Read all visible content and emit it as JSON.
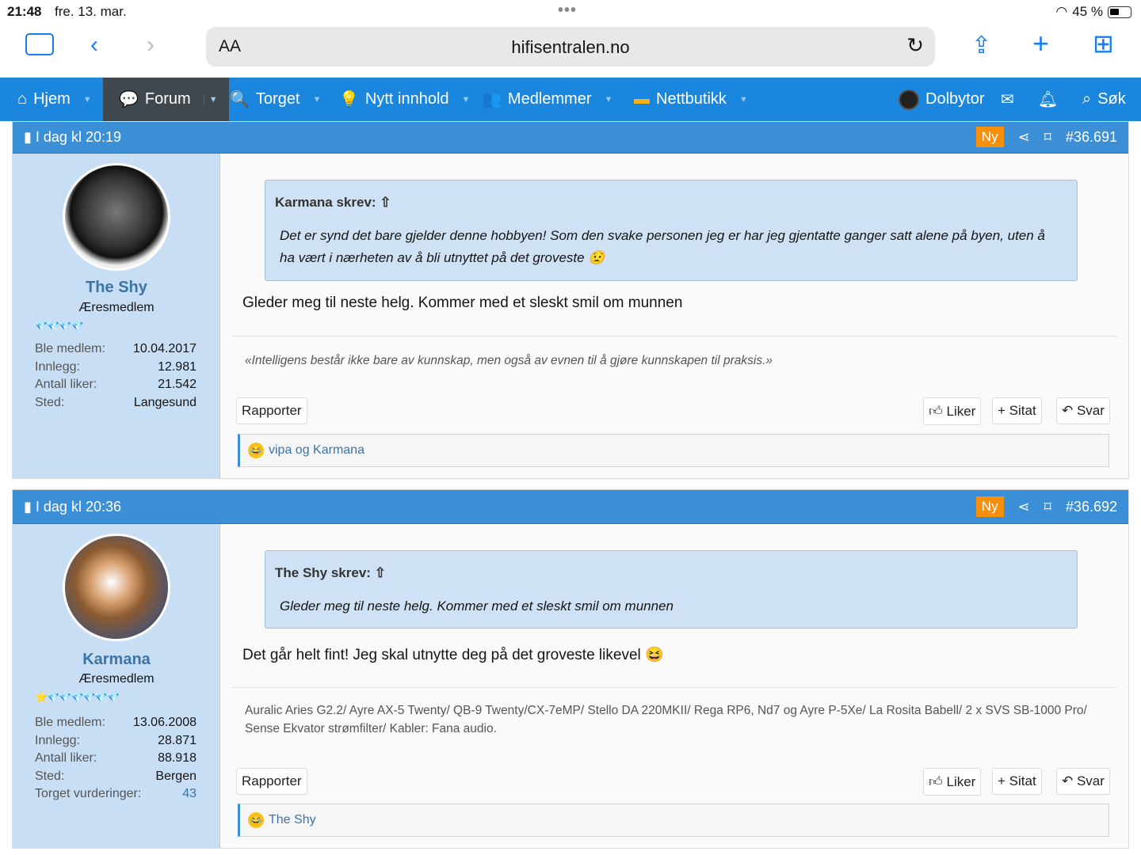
{
  "status": {
    "time": "21:48",
    "date": "fre. 13. mar.",
    "battery": "45 %"
  },
  "browser": {
    "text_size": "AA",
    "host": "hifisentralen.no"
  },
  "nav": {
    "items": [
      {
        "label": "Hjem"
      },
      {
        "label": "Forum"
      },
      {
        "label": "Torget"
      },
      {
        "label": "Nytt innhold"
      },
      {
        "label": "Medlemmer"
      },
      {
        "label": "Nettbutikk"
      }
    ],
    "user": "Dolbytor",
    "search": "Søk"
  },
  "posts": [
    {
      "date": "I dag kl 20:19",
      "badge": "Ny",
      "number": "#36.691",
      "username": "The Shy",
      "user_title": "Æresmedlem",
      "stats": [
        {
          "k": "Ble medlem:",
          "v": "10.04.2017"
        },
        {
          "k": "Innlegg:",
          "v": "12.981"
        },
        {
          "k": "Antall liker:",
          "v": "21.542"
        },
        {
          "k": "Sted:",
          "v": "Langesund"
        }
      ],
      "quote_author": "Karmana skrev:",
      "quote_text": "Det er synd det bare gjelder denne hobbyen! Som den svake personen jeg er har jeg gjentatte ganger satt alene på byen, uten å ha vært i nærheten av å bli utnyttet på det groveste 😟",
      "body": "Gleder meg til neste helg. Kommer med et sleskt smil om munnen",
      "signature": "«Intelligens består ikke bare av kunnskap, men også av evnen til å gjøre kunnskapen til praksis.»",
      "reactions": "vipa og Karmana"
    },
    {
      "date": "I dag kl 20:36",
      "badge": "Ny",
      "number": "#36.692",
      "username": "Karmana",
      "user_title": "Æresmedlem",
      "stats": [
        {
          "k": "Ble medlem:",
          "v": "13.06.2008"
        },
        {
          "k": "Innlegg:",
          "v": "28.871"
        },
        {
          "k": "Antall liker:",
          "v": "88.918"
        },
        {
          "k": "Sted:",
          "v": "Bergen"
        },
        {
          "k": "Torget vurderinger:",
          "v": "43"
        }
      ],
      "quote_author": "The Shy skrev:",
      "quote_text": "Gleder meg til neste helg. Kommer med et sleskt smil om munnen",
      "body": "Det går helt fint! Jeg skal utnytte deg på det groveste likevel 😆",
      "signature": "Auralic Aries G2.2/ Ayre AX-5 Twenty/ QB-9 Twenty/CX-7eMP/ Stello DA 220MKII/ Rega RP6, Nd7 og Ayre P-5Xe/ La Rosita Babell/ 2 x SVS SB-1000 Pro/ Sense Ekvator strømfilter/ Kabler: Fana audio.",
      "reactions": "The Shy"
    }
  ],
  "actions": {
    "report": "Rapporter",
    "like": "Liker",
    "quote": "Sitat",
    "reply": "Svar"
  }
}
